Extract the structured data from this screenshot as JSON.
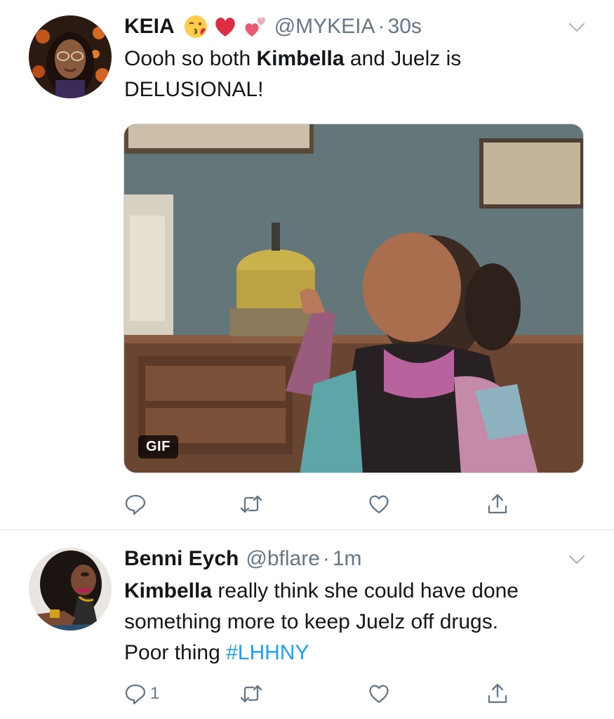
{
  "tweets": [
    {
      "display_name": "KEIA",
      "emojis": [
        "kissing-face-emoji",
        "red-heart-emoji",
        "two-hearts-emoji"
      ],
      "handle": "@MYKEIA",
      "separator": "·",
      "time": "30s",
      "text_line1_pre": "Oooh so both ",
      "text_line1_bold": "Kimbella",
      "text_line1_post": " and Juelz is",
      "text_line2": "DELUSIONAL!",
      "media_badge": "GIF",
      "reply_count": "",
      "icons": [
        "reply-icon",
        "retweet-icon",
        "like-icon",
        "share-icon"
      ]
    },
    {
      "display_name": "Benni Eych",
      "handle": "@bflare",
      "separator": "·",
      "time": "1m",
      "text_bold": "Kimbella",
      "text_line1_post": " really think she could have done",
      "text_line2": "something more to keep Juelz off drugs.",
      "text_line3_pre": "Poor thing ",
      "hashtag": "#LHHNY",
      "reply_count": "1",
      "icons": [
        "reply-icon",
        "retweet-icon",
        "like-icon",
        "share-icon"
      ]
    }
  ],
  "colors": {
    "text": "#14171a",
    "secondary": "#657786",
    "link": "#1da1f2",
    "divider": "#e1e8ed"
  }
}
